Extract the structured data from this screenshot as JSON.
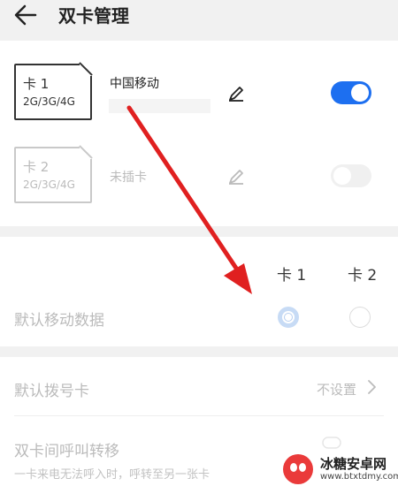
{
  "header": {
    "title": "双卡管理"
  },
  "sim_cards": [
    {
      "slot_label": "卡 1",
      "network": "2G/3G/4G",
      "carrier": "中国移动",
      "enabled": true
    },
    {
      "slot_label": "卡 2",
      "network": "2G/3G/4G",
      "carrier": "未插卡",
      "enabled": false
    }
  ],
  "default_data": {
    "columns": [
      "卡 1",
      "卡 2"
    ],
    "label": "默认移动数据",
    "selected": "卡 1"
  },
  "default_dial": {
    "label": "默认拨号卡",
    "value": "不设置"
  },
  "call_forward": {
    "label": "双卡间呼叫转移",
    "description": "一卡来电无法呼入时，呼转至另一张卡"
  },
  "watermark": {
    "name": "冰糖安卓网",
    "url": "www.btxtdmy.com"
  },
  "colors": {
    "accent": "#1d6ff0",
    "annotation_arrow": "#e02020"
  }
}
